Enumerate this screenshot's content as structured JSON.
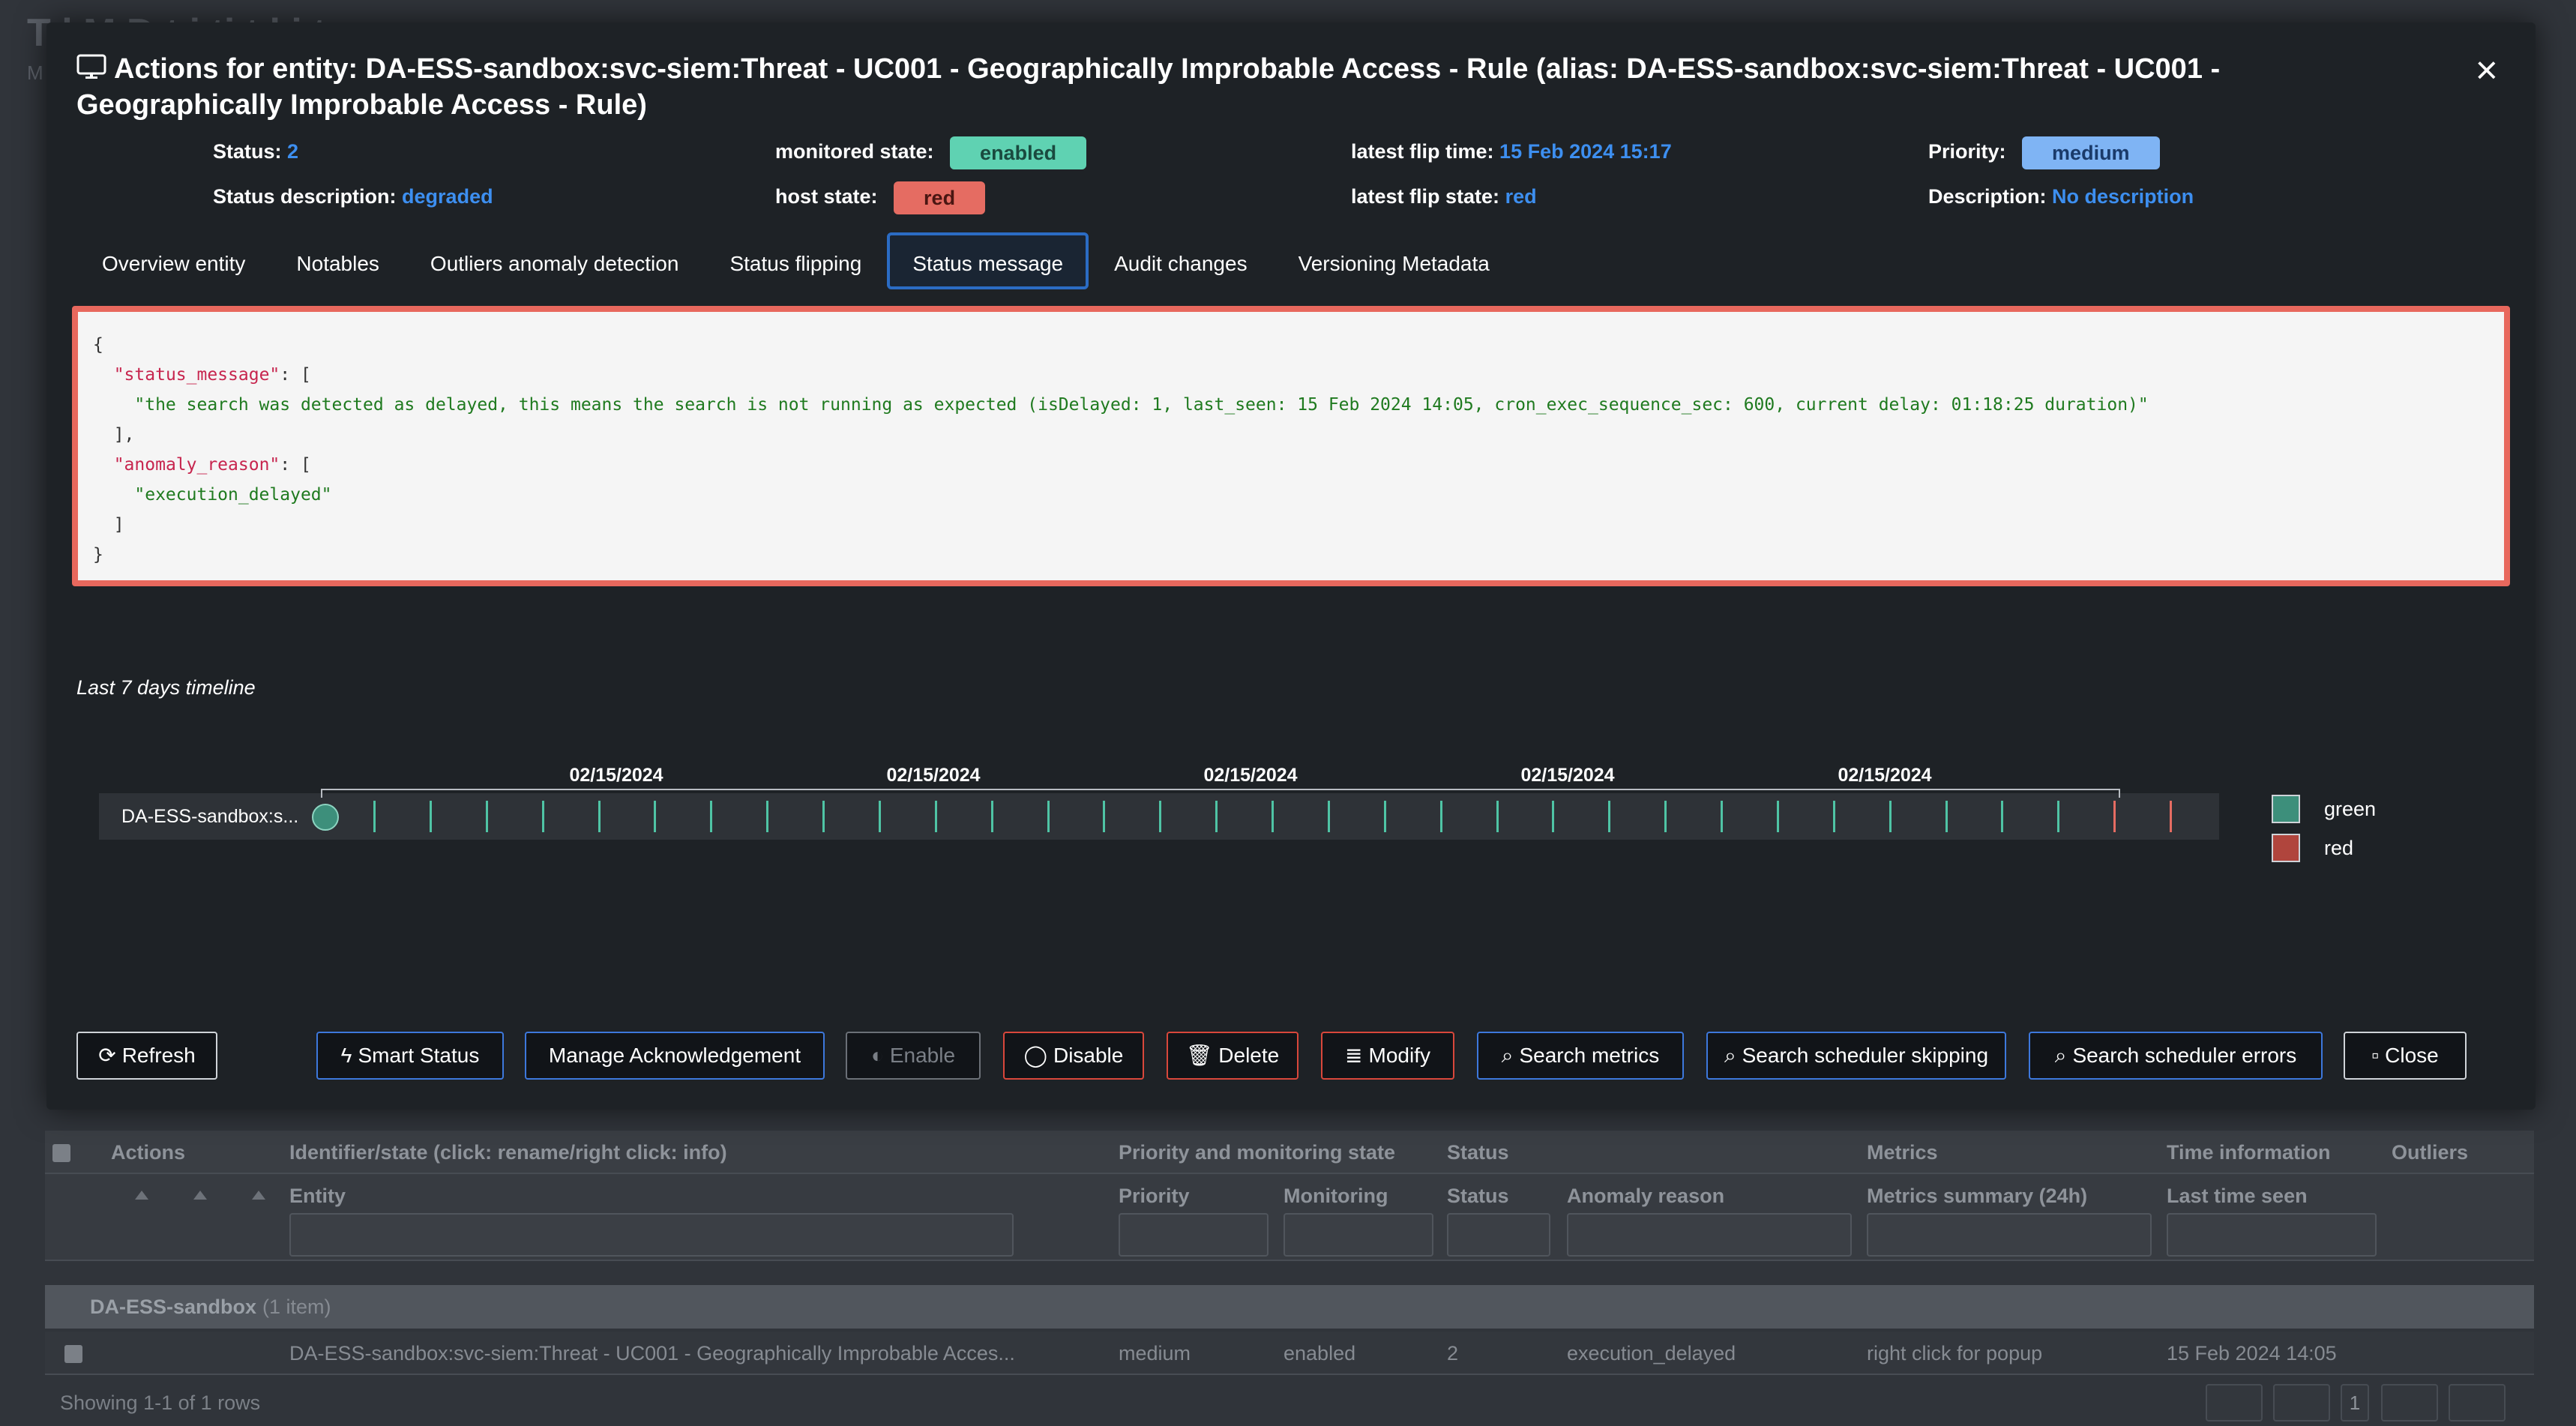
{
  "background": {
    "title_partial": "T   l M    D t   i      ti   t  ki      t",
    "subtitle_partial": "M",
    "grid": {
      "headers": [
        "Actions",
        "Identifier/state (click: rename/right click: info)",
        "Priority and monitoring state",
        "Status",
        "Metrics",
        "Time information",
        "Outliers"
      ],
      "subheaders": [
        "Entity",
        "Priority",
        "Monitoring",
        "Status",
        "Anomaly reason",
        "Metrics summary (24h)",
        "Last time seen"
      ],
      "group_label": "DA-ESS-sandbox",
      "group_count": "(1 item)",
      "row": {
        "entity": "DA-ESS-sandbox:svc-siem:Threat - UC001 - Geographically Improbable Acces...",
        "priority": "medium",
        "monitoring": "enabled",
        "status": "2",
        "anomaly_reason": "execution_delayed",
        "metrics_summary": "right click for popup",
        "last_time_seen": "15 Feb 2024 14:05"
      },
      "footer": "Showing 1-1 of 1 rows",
      "page_number": "1"
    }
  },
  "modal": {
    "title": "Actions for entity: DA-ESS-sandbox:svc-siem:Threat - UC001 - Geographically Improbable Access - Rule (alias: DA-ESS-sandbox:svc-siem:Threat - UC001 - Geographically Improbable Access - Rule)",
    "close_glyph": "×",
    "info": {
      "status_label": "Status:",
      "status_value": "2",
      "status_desc_label": "Status description:",
      "status_desc_value": "degraded",
      "monitored_state_label": "monitored state:",
      "monitored_state_value": "enabled",
      "host_state_label": "host state:",
      "host_state_value": "red",
      "latest_flip_time_label": "latest flip time:",
      "latest_flip_time_value": "15 Feb 2024 15:17",
      "latest_flip_state_label": "latest flip state:",
      "latest_flip_state_value": "red",
      "priority_label": "Priority:",
      "priority_value": "medium",
      "description_label": "Description:",
      "description_value": "No description"
    },
    "tabs": [
      {
        "label": "Overview entity",
        "active": false
      },
      {
        "label": "Notables",
        "active": false
      },
      {
        "label": "Outliers anomaly detection",
        "active": false
      },
      {
        "label": "Status flipping",
        "active": false
      },
      {
        "label": "Status message",
        "active": true
      },
      {
        "label": "Audit changes",
        "active": false
      },
      {
        "label": "Versioning Metadata",
        "active": false
      }
    ],
    "status_json": {
      "key1": "\"status_message\"",
      "value1": "\"the search was detected as delayed, this means the search is not running as expected (isDelayed: 1, last_seen: 15 Feb 2024 14:05, cron_exec_sequence_sec: 600, current delay: 01:18:25 duration)\"",
      "key2": "\"anomaly_reason\"",
      "value2": "\"execution_delayed\""
    },
    "timeline": {
      "label": "Last 7 days timeline",
      "entity_label": "DA-ESS-sandbox:s...",
      "date_labels": [
        "02/15/2024",
        "02/15/2024",
        "02/15/2024",
        "02/15/2024",
        "02/15/2024"
      ],
      "ticks": [
        "green",
        "green",
        "green",
        "green",
        "green",
        "green",
        "green",
        "green",
        "green",
        "green",
        "green",
        "green",
        "green",
        "green",
        "green",
        "green",
        "green",
        "green",
        "green",
        "green",
        "green",
        "green",
        "green",
        "green",
        "green",
        "green",
        "green",
        "green",
        "green",
        "green",
        "green",
        "red",
        "red"
      ],
      "legend": [
        {
          "label": "green",
          "color": "#3d8f7b"
        },
        {
          "label": "red",
          "color": "#b0453d"
        }
      ]
    },
    "buttons": {
      "refresh": "Refresh",
      "smart_status": "Smart Status",
      "manage_ack": "Manage Acknowledgement",
      "enable": "Enable",
      "disable": "Disable",
      "delete": "Delete",
      "modify": "Modify",
      "search_metrics": "Search metrics",
      "search_scheduler_skipping": "Search scheduler skipping",
      "search_scheduler_errors": "Search scheduler errors",
      "close": "Close"
    }
  }
}
